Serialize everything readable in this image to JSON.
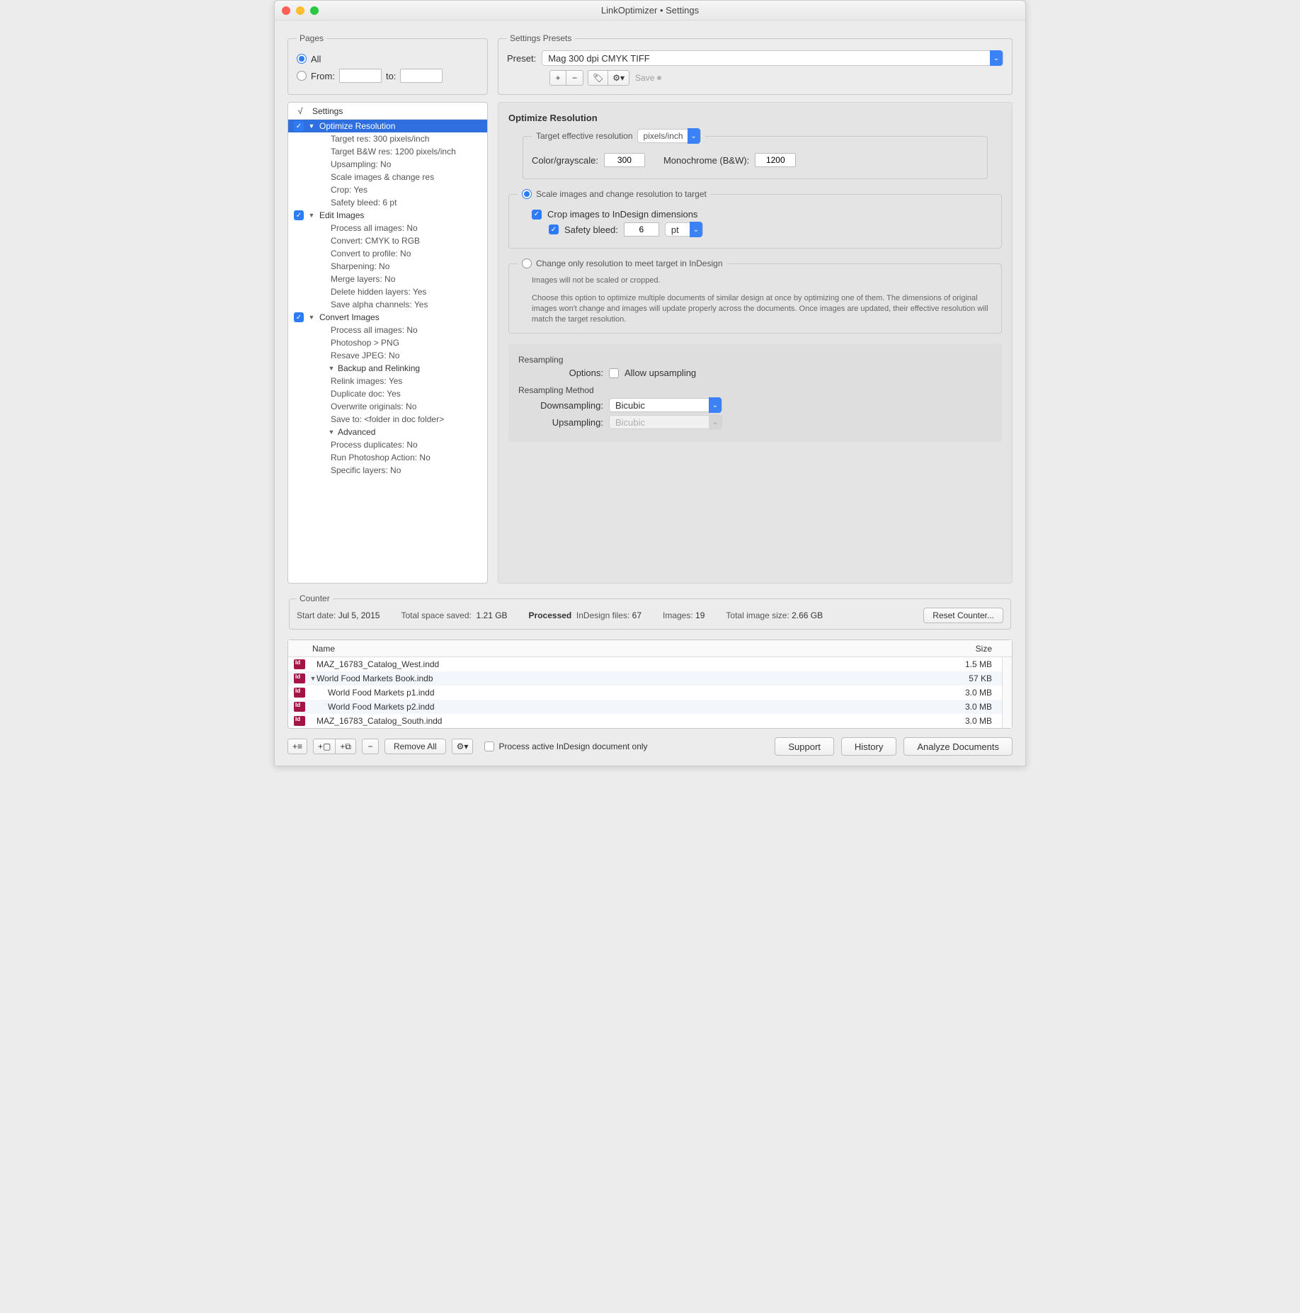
{
  "window": {
    "title": "LinkOptimizer • Settings"
  },
  "pages": {
    "legend": "Pages",
    "all_label": "All",
    "from_label": "From:",
    "to_label": "to:",
    "from_value": "",
    "to_value": ""
  },
  "presets": {
    "legend": "Settings Presets",
    "label": "Preset:",
    "selected": "Mag 300 dpi CMYK TIFF",
    "save_label": "Save"
  },
  "tree": {
    "header_check": "√",
    "header_label": "Settings",
    "optimize": {
      "title": "Optimize Resolution",
      "items": [
        "Target res: 300 pixels/inch",
        "Target B&W res: 1200 pixels/inch",
        "Upsampling: No",
        "Scale images & change res",
        "Crop: Yes",
        "Safety bleed: 6 pt"
      ]
    },
    "edit": {
      "title": "Edit Images",
      "items": [
        "Process all images: No",
        "Convert: CMYK to RGB",
        "Convert to profile: No",
        "Sharpening: No",
        "Merge layers: No",
        "Delete hidden layers: Yes",
        "Save alpha channels: Yes"
      ]
    },
    "convert": {
      "title": "Convert Images",
      "items": [
        "Process all images: No",
        "Photoshop > PNG",
        "Resave JPEG: No"
      ]
    },
    "backup": {
      "title": "Backup and Relinking",
      "items": [
        "Relink images: Yes",
        "Duplicate doc: Yes",
        "Overwrite originals: No",
        "Save to: <folder in doc folder>"
      ]
    },
    "advanced": {
      "title": "Advanced",
      "items": [
        "Process duplicates: No",
        "Run Photoshop Action: No",
        "Specific layers: No"
      ]
    }
  },
  "panel": {
    "title": "Optimize Resolution",
    "target_legend": "Target effective resolution",
    "target_unit": "pixels/inch",
    "color_label": "Color/grayscale:",
    "color_value": "300",
    "mono_label": "Monochrome (B&W):",
    "mono_value": "1200",
    "scale_label": "Scale images and change resolution to target",
    "crop_label": "Crop images to InDesign dimensions",
    "bleed_label": "Safety bleed:",
    "bleed_value": "6",
    "bleed_unit": "pt",
    "change_label": "Change only resolution to meet target in InDesign",
    "change_hint1": "Images will not be scaled or cropped.",
    "change_hint2": "Choose this option to optimize multiple documents of similar design at once by optimizing one of them. The dimensions of original images won't change and images will update properly across the documents. Once images are updated, their effective resolution will match the target resolution.",
    "resampling_title": "Resampling",
    "options_label": "Options:",
    "allow_upsampling": "Allow upsampling",
    "method_title": "Resampling Method",
    "downsampling_label": "Downsampling:",
    "downsampling_value": "Bicubic",
    "upsampling_label": "Upsampling:",
    "upsampling_value": "Bicubic"
  },
  "counter": {
    "legend": "Counter",
    "start_label": "Start date:",
    "start_value": "Jul 5, 2015",
    "space_label": "Total space saved:",
    "space_value": "1.21 GB",
    "processed_label": "Processed",
    "indd_label": "InDesign files:",
    "indd_value": "67",
    "images_label": "Images:",
    "images_value": "19",
    "total_label": "Total image size:",
    "total_value": "2.66 GB",
    "reset_label": "Reset Counter..."
  },
  "files": {
    "col_name": "Name",
    "col_size": "Size",
    "rows": [
      {
        "name": "MAZ_16783_Catalog_West.indd",
        "size": "1.5 MB",
        "indent": 0,
        "tri": ""
      },
      {
        "name": "World Food Markets Book.indb",
        "size": "57 KB",
        "indent": 0,
        "tri": "▼"
      },
      {
        "name": "World Food Markets p1.indd",
        "size": "3.0 MB",
        "indent": 1,
        "tri": ""
      },
      {
        "name": "World Food Markets p2.indd",
        "size": "3.0 MB",
        "indent": 1,
        "tri": ""
      },
      {
        "name": "MAZ_16783_Catalog_South.indd",
        "size": "3.0 MB",
        "indent": 0,
        "tri": ""
      }
    ]
  },
  "bottom": {
    "remove_all": "Remove All",
    "proc_active": "Process active InDesign document only",
    "support": "Support",
    "history": "History",
    "analyze": "Analyze Documents"
  }
}
